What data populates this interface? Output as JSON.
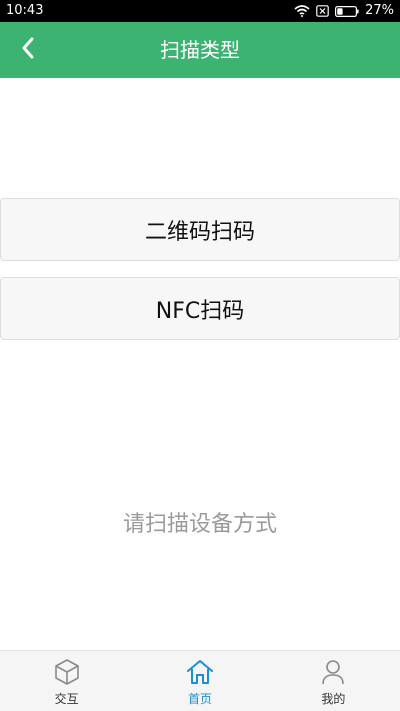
{
  "status_bar": {
    "time": "10:43",
    "battery": "27%",
    "icons": [
      "wifi-icon",
      "sim-disabled-icon",
      "battery-icon"
    ]
  },
  "header": {
    "title": "扫描类型",
    "back_icon": "chevron-left-icon",
    "color": "#3cb371"
  },
  "options": {
    "qr_label": "二维码扫码",
    "nfc_label": "NFC扫码"
  },
  "hint": "请扫描设备方式",
  "bottom_nav": {
    "items": [
      {
        "label": "交互",
        "icon": "cube-icon"
      },
      {
        "label": "首页",
        "icon": "home-icon",
        "active": true
      },
      {
        "label": "我的",
        "icon": "user-icon"
      }
    ],
    "active_color": "#1a8fd1"
  }
}
